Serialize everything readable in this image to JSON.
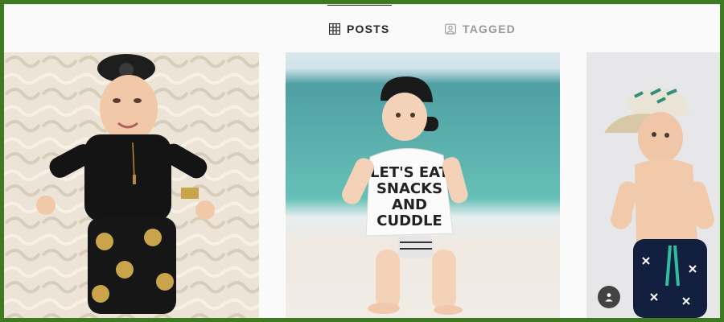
{
  "profile_tabs": {
    "posts_label": "POSTS",
    "tagged_label": "TAGGED",
    "active_tab": "POSTS",
    "posts_icon": "grid-icon",
    "tagged_icon": "tag-person-icon",
    "active_color": "#262626",
    "inactive_color": "#999999"
  },
  "posts": [
    {
      "subject": "baby on fur blanket"
    },
    {
      "subject": "toddler on beach",
      "shirt_text": [
        "LET'S EAT",
        "SNACKS",
        "AND",
        "CUDDLE"
      ]
    },
    {
      "subject": "toddler in cap",
      "badge_icon": "tagged-user-icon"
    }
  ],
  "frame_color": "#3d7a22"
}
